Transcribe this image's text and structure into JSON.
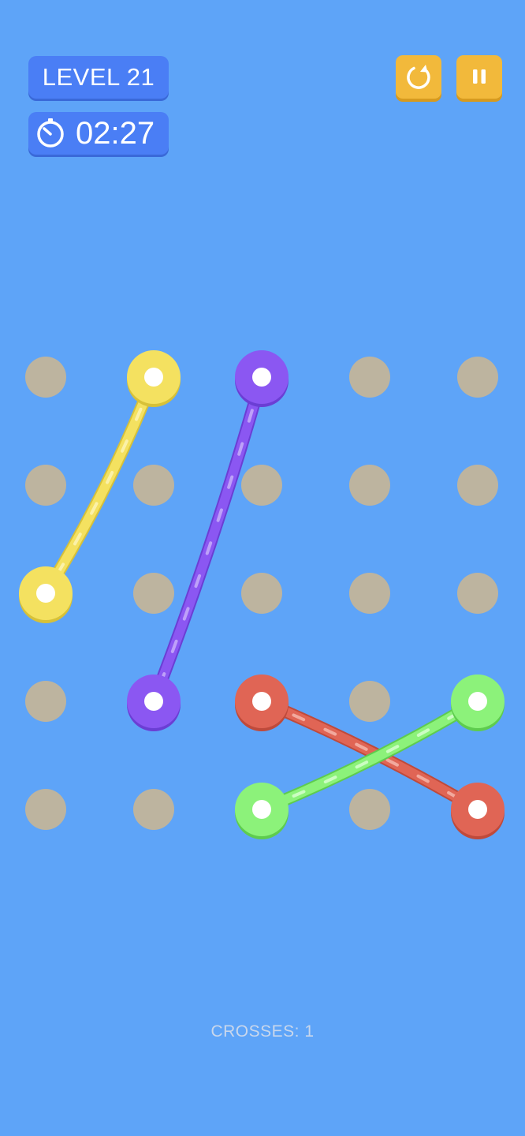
{
  "hud": {
    "level_label": "LEVEL 21",
    "timer_value": "02:27"
  },
  "controls": {
    "restart_icon": "restart-icon",
    "pause_icon": "pause-icon",
    "timer_icon": "stopwatch-icon"
  },
  "colors": {
    "background": "#5ea4f8",
    "peg": "#bdb49f",
    "yellow": "#f4e160",
    "purple": "#8b57f2",
    "red": "#e06555",
    "green": "#8cf27a"
  },
  "board": {
    "grid_columns": 5,
    "grid_rows": 5,
    "ropes": [
      {
        "color": "yellow",
        "from": [
          1,
          0
        ],
        "to": [
          0,
          2
        ]
      },
      {
        "color": "purple",
        "from": [
          2,
          0
        ],
        "to": [
          1,
          3
        ]
      },
      {
        "color": "red",
        "from": [
          2,
          3
        ],
        "to": [
          4,
          4
        ]
      },
      {
        "color": "green",
        "from": [
          2,
          4
        ],
        "to": [
          4,
          3
        ]
      }
    ]
  },
  "status": {
    "crosses_text": "CROSSES: 1"
  }
}
